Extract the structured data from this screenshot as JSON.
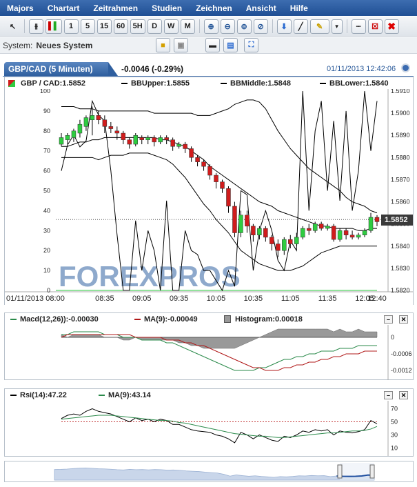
{
  "menu": [
    "Majors",
    "Chartart",
    "Zeitrahmen",
    "Studien",
    "Zeichnen",
    "Ansicht",
    "Hilfe"
  ],
  "toolbar": {
    "timeframes": [
      "1",
      "5",
      "15",
      "60",
      "5H",
      "D",
      "W",
      "M"
    ]
  },
  "system": {
    "label": "System:",
    "value": "Neues System"
  },
  "header": {
    "symbol_tab": "GBP/CAD (5 Minuten)",
    "change": "-0.0046 (-0.29%)",
    "datetime": "01/11/2013 12:42:06"
  },
  "main_legend": {
    "symbol": "GBP / CAD:1.5852",
    "bb_upper": "BBUpper:1.5855",
    "bb_middle": "BBMiddle:1.5848",
    "bb_lower": "BBLower:1.5840"
  },
  "price_tag": "1.5852",
  "watermark": "FOREXPROS",
  "colors": {
    "up": "#2ecc40",
    "down": "#d01c1c",
    "accent": "#2a5a9a"
  },
  "macd_legend": {
    "macd": "Macd(12,26)):-0.00030",
    "ma": "MA(9):-0.00049",
    "hist": "Histogram:0.00018"
  },
  "rsi_legend": {
    "rsi": "Rsi(14):47.22",
    "ma": "MA(9):43.14"
  },
  "chart_data": [
    {
      "type": "candlestick",
      "y_right": {
        "ylim": [
          1.582,
          1.591
        ],
        "ticks": [
          "1.5910",
          "1.5900",
          "1.5890",
          "1.5880",
          "1.5870",
          "1.5860",
          "1.5850",
          "1.5840",
          "1.5830",
          "1.5820"
        ]
      },
      "y_left": {
        "ylim": [
          0,
          100
        ],
        "ticks": [
          "100",
          "90",
          "80",
          "70",
          "60",
          "50",
          "40",
          "30",
          "20",
          "10",
          "0"
        ]
      },
      "x_ticks": [
        "01/11/2013 08:00",
        "08:35",
        "09:05",
        "09:35",
        "10:05",
        "10:35",
        "11:05",
        "11:35",
        "12:05",
        "12:40"
      ],
      "candles": [
        [
          1.5886,
          1.5889,
          1.5885,
          1.5891
        ],
        [
          1.5888,
          1.589,
          1.5886,
          1.5891
        ],
        [
          1.5889,
          1.5892,
          1.5887,
          1.5893
        ],
        [
          1.5891,
          1.5895,
          1.5889,
          1.5897
        ],
        [
          1.5894,
          1.5898,
          1.5892,
          1.5899
        ],
        [
          1.5897,
          1.5899,
          1.589,
          1.5903
        ],
        [
          1.5899,
          1.5897,
          1.5895,
          1.5901
        ],
        [
          1.5897,
          1.5894,
          1.5891,
          1.5899
        ],
        [
          1.5894,
          1.5893,
          1.5891,
          1.5896
        ],
        [
          1.5892,
          1.5891,
          1.5888,
          1.5894
        ],
        [
          1.5891,
          1.5888,
          1.5886,
          1.5892
        ],
        [
          1.5888,
          1.5886,
          1.5884,
          1.5889
        ],
        [
          1.5886,
          1.589,
          1.5885,
          1.5891
        ],
        [
          1.5889,
          1.5888,
          1.5886,
          1.589
        ],
        [
          1.5888,
          1.5889,
          1.5886,
          1.589
        ],
        [
          1.5889,
          1.5887,
          1.5885,
          1.589
        ],
        [
          1.5887,
          1.5889,
          1.5886,
          1.589
        ],
        [
          1.5889,
          1.5888,
          1.5886,
          1.589
        ],
        [
          1.5888,
          1.5885,
          1.5883,
          1.5889
        ],
        [
          1.5885,
          1.5886,
          1.5884,
          1.5887
        ],
        [
          1.5886,
          1.5884,
          1.5882,
          1.5887
        ],
        [
          1.5884,
          1.588,
          1.5878,
          1.5885
        ],
        [
          1.588,
          1.5878,
          1.5876,
          1.5881
        ],
        [
          1.5878,
          1.5876,
          1.5874,
          1.5879
        ],
        [
          1.5876,
          1.5872,
          1.587,
          1.5877
        ],
        [
          1.5872,
          1.5869,
          1.5866,
          1.5873
        ],
        [
          1.5869,
          1.5866,
          1.5864,
          1.587
        ],
        [
          1.5866,
          1.5858,
          1.5855,
          1.5867
        ],
        [
          1.5858,
          1.5846,
          1.5844,
          1.586
        ],
        [
          1.5846,
          1.5854,
          1.5844,
          1.5856
        ],
        [
          1.5854,
          1.5849,
          1.5846,
          1.5856
        ],
        [
          1.5849,
          1.5845,
          1.5842,
          1.585
        ],
        [
          1.5845,
          1.5848,
          1.5843,
          1.5849
        ],
        [
          1.5848,
          1.5844,
          1.5842,
          1.5849
        ],
        [
          1.5844,
          1.5841,
          1.5838,
          1.5845
        ],
        [
          1.5841,
          1.5838,
          1.5835,
          1.5843
        ],
        [
          1.5838,
          1.5843,
          1.5836,
          1.5844
        ],
        [
          1.5843,
          1.5841,
          1.5839,
          1.5845
        ],
        [
          1.5841,
          1.5844,
          1.584,
          1.5846
        ],
        [
          1.5844,
          1.5848,
          1.5843,
          1.5849
        ],
        [
          1.5848,
          1.5847,
          1.5845,
          1.585
        ],
        [
          1.5847,
          1.585,
          1.5846,
          1.5851
        ],
        [
          1.585,
          1.5848,
          1.5847,
          1.5851
        ],
        [
          1.5848,
          1.5849,
          1.5847,
          1.585
        ],
        [
          1.5849,
          1.5843,
          1.5842,
          1.585
        ],
        [
          1.5843,
          1.5847,
          1.5842,
          1.5848
        ],
        [
          1.5847,
          1.5845,
          1.5843,
          1.5848
        ],
        [
          1.5845,
          1.5844,
          1.5843,
          1.5847
        ],
        [
          1.5844,
          1.5845,
          1.5843,
          1.5846
        ],
        [
          1.5845,
          1.5847,
          1.5844,
          1.5848
        ],
        [
          1.5847,
          1.5853,
          1.5846,
          1.5855
        ],
        [
          1.5853,
          1.5851,
          1.5849,
          1.5854
        ]
      ],
      "bb_upper": [
        1.5903,
        1.5903,
        1.5903,
        1.5902,
        1.5902,
        1.5902,
        1.5901,
        1.5901,
        1.5901,
        1.5901,
        1.5901,
        1.5901,
        1.5901,
        1.5901,
        1.5901,
        1.59,
        1.59,
        1.59,
        1.59,
        1.59,
        1.59,
        1.59,
        1.5899,
        1.5899,
        1.5899,
        1.59,
        1.5901,
        1.5902,
        1.5904,
        1.5905,
        1.5906,
        1.5906,
        1.5905,
        1.5902,
        1.5897,
        1.5892,
        1.5888,
        1.5884,
        1.5881,
        1.5878,
        1.5875,
        1.5873,
        1.5871,
        1.5869,
        1.5867,
        1.5865,
        1.5862,
        1.586,
        1.5859,
        1.5858,
        1.5856,
        1.5855
      ],
      "bb_middle": [
        1.5885,
        1.5885,
        1.5886,
        1.5887,
        1.5887,
        1.5888,
        1.5888,
        1.5889,
        1.5889,
        1.5889,
        1.5889,
        1.5889,
        1.5889,
        1.5889,
        1.5889,
        1.5889,
        1.5888,
        1.5888,
        1.5887,
        1.5886,
        1.5885,
        1.5883,
        1.5881,
        1.5879,
        1.5876,
        1.5874,
        1.5872,
        1.587,
        1.5868,
        1.5866,
        1.5864,
        1.5862,
        1.586,
        1.5859,
        1.5858,
        1.5856,
        1.5855,
        1.5854,
        1.5853,
        1.5852,
        1.5851,
        1.585,
        1.5849,
        1.5849,
        1.5848,
        1.5848,
        1.5848,
        1.5848,
        1.5847,
        1.5847,
        1.5848,
        1.5848
      ],
      "bb_lower": [
        1.588,
        1.588,
        1.588,
        1.588,
        1.588,
        1.588,
        1.5879,
        1.588,
        1.5881,
        1.5881,
        1.5881,
        1.5882,
        1.5882,
        1.5882,
        1.5882,
        1.5881,
        1.588,
        1.5879,
        1.5877,
        1.5874,
        1.5871,
        1.5867,
        1.5863,
        1.5859,
        1.5856,
        1.5852,
        1.5849,
        1.5846,
        1.5842,
        1.5838,
        1.5836,
        1.5834,
        1.5832,
        1.5831,
        1.583,
        1.5829,
        1.5829,
        1.5829,
        1.583,
        1.5831,
        1.5833,
        1.5835,
        1.5837,
        1.5838,
        1.5839,
        1.584,
        1.584,
        1.584,
        1.584,
        1.584,
        1.584,
        1.584
      ],
      "left_oscillator": [
        60,
        73,
        78,
        72,
        75,
        95,
        88,
        85,
        60,
        28,
        0,
        0,
        35,
        10,
        30,
        20,
        0,
        45,
        0,
        0,
        30,
        20,
        18,
        10,
        10,
        5,
        0,
        10,
        2,
        50,
        48,
        10,
        30,
        40,
        30,
        15,
        10,
        25,
        20,
        100,
        40,
        80,
        95,
        50,
        85,
        45,
        90,
        40,
        60,
        100,
        70,
        95
      ]
    },
    {
      "type": "line",
      "name": "MACD",
      "ylim": [
        -0.0014,
        0.0003
      ],
      "ticks": [
        "0",
        "-0.0006",
        "-0.0012"
      ],
      "macd": [
        0.0001,
        0.0001,
        0.0002,
        0.0002,
        0.0002,
        0.0002,
        0.0002,
        0.0001,
        0.0001,
        0.0001,
        0.0,
        0.0,
        0.0,
        -0.0001,
        -0.0001,
        -0.0001,
        -0.0001,
        -0.0002,
        -0.0002,
        -0.0003,
        -0.0004,
        -0.0005,
        -0.0006,
        -0.0007,
        -0.0008,
        -0.0009,
        -0.001,
        -0.0011,
        -0.0012,
        -0.0012,
        -0.0012,
        -0.0012,
        -0.0011,
        -0.0011,
        -0.001,
        -0.0009,
        -0.0008,
        -0.0008,
        -0.0007,
        -0.0007,
        -0.0006,
        -0.0006,
        -0.0005,
        -0.0005,
        -0.0005,
        -0.0004,
        -0.0004,
        -0.0004,
        -0.0003,
        -0.0003,
        -0.0003,
        -0.0003
      ],
      "ma": [
        0.0,
        0.0001,
        0.0001,
        0.0001,
        0.0001,
        0.0001,
        0.0001,
        0.0001,
        0.0001,
        0.0001,
        0.0001,
        0.0001,
        0.0,
        0.0,
        0.0,
        0.0,
        0.0,
        -0.0001,
        -0.0001,
        -0.0001,
        -0.0002,
        -0.0002,
        -0.0003,
        -0.0003,
        -0.0004,
        -0.0005,
        -0.0006,
        -0.0007,
        -0.0008,
        -0.0009,
        -0.001,
        -0.0011,
        -0.0011,
        -0.0012,
        -0.0012,
        -0.0012,
        -0.0011,
        -0.0011,
        -0.001,
        -0.001,
        -0.0009,
        -0.0009,
        -0.0008,
        -0.0008,
        -0.0007,
        -0.0007,
        -0.0006,
        -0.0006,
        -0.0006,
        -0.0005,
        -0.0005,
        -0.0005
      ]
    },
    {
      "type": "line",
      "name": "RSI",
      "ylim": [
        0,
        80
      ],
      "ticks": [
        "70",
        "50",
        "30",
        "10"
      ],
      "ref": 50,
      "rsi": [
        55,
        60,
        62,
        60,
        66,
        70,
        66,
        64,
        62,
        58,
        54,
        50,
        56,
        52,
        54,
        50,
        54,
        52,
        46,
        46,
        42,
        38,
        36,
        35,
        34,
        30,
        28,
        24,
        18,
        34,
        30,
        24,
        30,
        26,
        22,
        20,
        28,
        26,
        30,
        36,
        34,
        38,
        36,
        38,
        30,
        36,
        34,
        33,
        35,
        38,
        52,
        47
      ],
      "ma": [
        54,
        55,
        56,
        57,
        58,
        59,
        60,
        60,
        60,
        59,
        58,
        57,
        56,
        55,
        54,
        53,
        52,
        52,
        51,
        49,
        48,
        46,
        44,
        42,
        40,
        38,
        36,
        34,
        32,
        31,
        30,
        29,
        28,
        28,
        27,
        26,
        26,
        27,
        28,
        29,
        30,
        31,
        32,
        33,
        33,
        34,
        35,
        36,
        36,
        37,
        39,
        43
      ]
    }
  ]
}
